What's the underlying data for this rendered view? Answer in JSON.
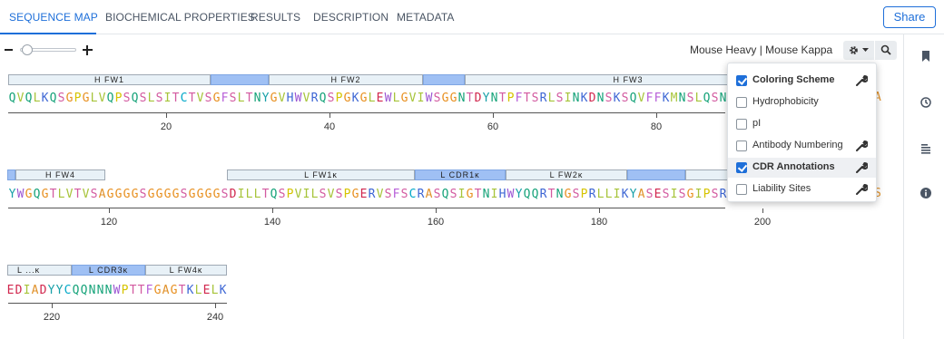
{
  "tabs": [
    {
      "label": "SEQUENCE MAP",
      "active": true
    },
    {
      "label": "BIOCHEMICAL PROPERTIES",
      "active": false
    },
    {
      "label": "RESULTS",
      "active": false
    },
    {
      "label": "DESCRIPTION",
      "active": false
    },
    {
      "label": "METADATA",
      "active": false
    }
  ],
  "share_label": "Share",
  "scheme_label": "Mouse Heavy | Mouse Kappa",
  "icons": {
    "zoom_out": "minus-icon",
    "zoom_in": "plus-icon",
    "settings": "gear-icon",
    "search": "search-icon",
    "sidebar": [
      "bookmark-icon",
      "history-icon",
      "list-icon",
      "info-icon"
    ]
  },
  "colors": {
    "accent": "#1e6fd9",
    "aa": {
      "A": "#e0912a",
      "C": "#00a8c8",
      "D": "#d1264d",
      "E": "#d1264d",
      "F": "#b85fd8",
      "G": "#e89020",
      "H": "#3d66d4",
      "I": "#a7c43a",
      "K": "#3d66d4",
      "L": "#a7c43a",
      "M": "#a7c43a",
      "N": "#17a37a",
      "P": "#d6c400",
      "Q": "#17a37a",
      "R": "#3d66d4",
      "S": "#d35aa0",
      "T": "#d35aa0",
      "V": "#a7c43a",
      "W": "#9b54d3",
      "Y": "#18a0a8"
    }
  },
  "rows": [
    {
      "sequence": "QVQLKQSGPGLVQPSQSLSITCTVSGFSLTNYGVHWVRQSPGKGLEWLGVIWSGGNTDYNTPFTSRLSINKDNSKSQVFFKMNSLQSN",
      "regions": [
        {
          "label": "H FW1",
          "cdr": false
        },
        {
          "label": "",
          "cdr": true
        },
        {
          "label": "H FW2",
          "cdr": false
        },
        {
          "label": "",
          "cdr": true
        },
        {
          "label": "H FW3",
          "cdr": false
        }
      ],
      "ticks": [
        "20",
        "40",
        "60",
        "80"
      ],
      "trailing_char": "A"
    },
    {
      "sequence": "YWGQGTLVTVSAGGGGSGGGGSGGGGSDILLTQSPVILSVSPGERVSFSCRASQSIGTNIHWYQQRTNGSPRLLIKYASESISGIPSR",
      "regions": [
        {
          "label": "",
          "cdr": true
        },
        {
          "label": "H FW4",
          "cdr": false
        },
        {
          "label": "L FW1κ",
          "cdr": false
        },
        {
          "label": "L CDR1κ",
          "cdr": true
        },
        {
          "label": "L FW2κ",
          "cdr": false
        },
        {
          "label": "",
          "cdr": true
        },
        {
          "label": "",
          "cdr": false
        }
      ],
      "ticks": [
        "120",
        "140",
        "160",
        "180",
        "200"
      ],
      "trailing_char": "S"
    },
    {
      "sequence": "EDIADYYCQQNNNWPTTFGAGTKLELK",
      "regions": [
        {
          "label": "L ...κ",
          "cdr": false
        },
        {
          "label": "L CDR3κ",
          "cdr": true
        },
        {
          "label": "L FW4κ",
          "cdr": false
        }
      ],
      "ticks": [
        "220",
        "240"
      ]
    }
  ],
  "dropdown": {
    "items": [
      {
        "label": "Coloring Scheme",
        "checked": true,
        "bold": true,
        "wrench": true,
        "highlight": false
      },
      {
        "label": "Hydrophobicity",
        "checked": false,
        "bold": false,
        "wrench": false,
        "highlight": false
      },
      {
        "label": "pI",
        "checked": false,
        "bold": false,
        "wrench": false,
        "highlight": false
      },
      {
        "label": "Antibody Numbering",
        "checked": false,
        "bold": false,
        "wrench": true,
        "highlight": false
      },
      {
        "label": "CDR Annotations",
        "checked": true,
        "bold": true,
        "wrench": true,
        "highlight": true
      },
      {
        "label": "Liability Sites",
        "checked": false,
        "bold": false,
        "wrench": true,
        "highlight": false
      }
    ]
  }
}
